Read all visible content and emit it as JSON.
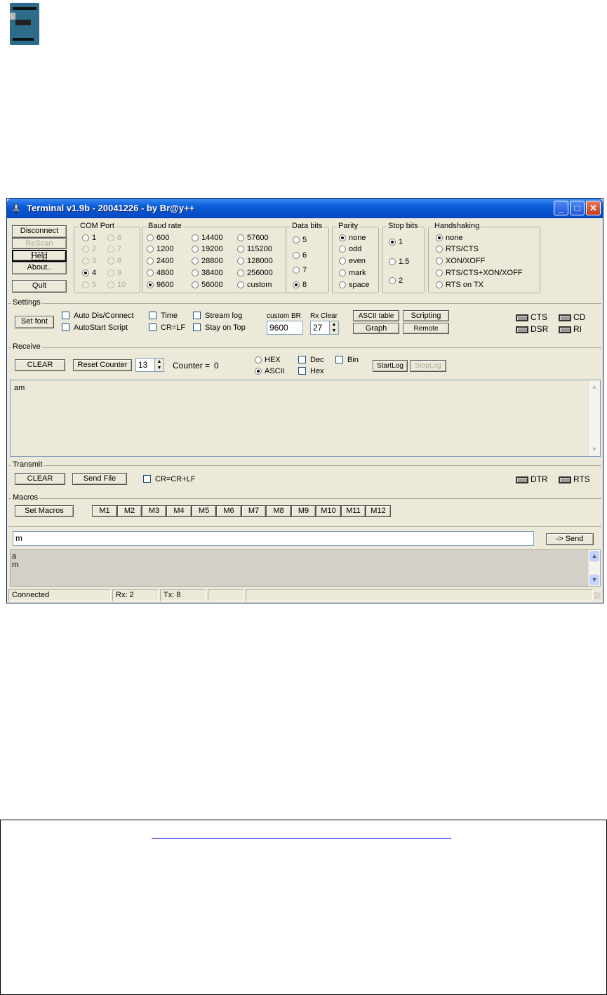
{
  "title": "Terminal v1.9b - 20041226 - by Br@y++",
  "buttons": {
    "disconnect": "Disconnect",
    "rescan": "ReScan",
    "help": "Help",
    "about": "About..",
    "quit": "Quit",
    "set_font": "Set font",
    "ascii_table": "ASCII table",
    "scripting": "Scripting",
    "graph": "Graph",
    "remote": "Remote",
    "rx_clear": "CLEAR",
    "reset_counter": "Reset Counter",
    "start_log": "StartLog",
    "stop_log": "StopLog",
    "tx_clear": "CLEAR",
    "send_file": "Send File",
    "set_macros": "Set Macros",
    "send": "-> Send"
  },
  "com_port": {
    "label": "COM Port",
    "ports": [
      "1",
      "2",
      "3",
      "4",
      "5",
      "6",
      "7",
      "8",
      "9",
      "10"
    ],
    "selected": "4"
  },
  "baud_rate": {
    "label": "Baud rate",
    "options": [
      "600",
      "1200",
      "2400",
      "4800",
      "9600",
      "14400",
      "19200",
      "28800",
      "38400",
      "56000",
      "57600",
      "115200",
      "128000",
      "256000",
      "custom"
    ],
    "selected": "9600"
  },
  "data_bits": {
    "label": "Data bits",
    "options": [
      "5",
      "6",
      "7",
      "8"
    ],
    "selected": "8"
  },
  "parity": {
    "label": "Parity",
    "options": [
      "none",
      "odd",
      "even",
      "mark",
      "space"
    ],
    "selected": "none"
  },
  "stop_bits": {
    "label": "Stop bits",
    "options": [
      "1",
      "1.5",
      "2"
    ],
    "selected": "1"
  },
  "handshaking": {
    "label": "Handshaking",
    "options": [
      "none",
      "RTS/CTS",
      "XON/XOFF",
      "RTS/CTS+XON/XOFF",
      "RTS on TX"
    ],
    "selected": "none"
  },
  "settings": {
    "label": "Settings",
    "auto_disconnect": "Auto Dis/Connect",
    "autostart_script": "AutoStart Script",
    "time": "Time",
    "cr_lf": "CR=LF",
    "stream_log": "Stream log",
    "stay_on_top": "Stay on Top",
    "custom_br_label": "custom BR",
    "custom_br_value": "9600",
    "rx_clear_label": "Rx Clear",
    "rx_clear_value": "27",
    "leds": [
      "CTS",
      "CD",
      "DSR",
      "RI"
    ]
  },
  "receive": {
    "label": "Receive",
    "counter_value_field": "13",
    "counter_label": "Counter =",
    "counter": "0",
    "hex": "HEX",
    "ascii": "ASCII",
    "dec": "Dec",
    "hex_check": "Hex",
    "bin": "Bin",
    "text": "am"
  },
  "transmit": {
    "label": "Transmit",
    "cr_crlf": "CR=CR+LF",
    "leds": [
      "DTR",
      "RTS"
    ]
  },
  "macros": {
    "label": "Macros",
    "items": [
      "M1",
      "M2",
      "M3",
      "M4",
      "M5",
      "M6",
      "M7",
      "M8",
      "M9",
      "M10",
      "M11",
      "M12"
    ]
  },
  "input": {
    "value": "m"
  },
  "tx_log": [
    "a",
    "m"
  ],
  "statusbar": {
    "connection": "Connected",
    "rx": "Rx: 2",
    "tx": "Tx: 8"
  }
}
